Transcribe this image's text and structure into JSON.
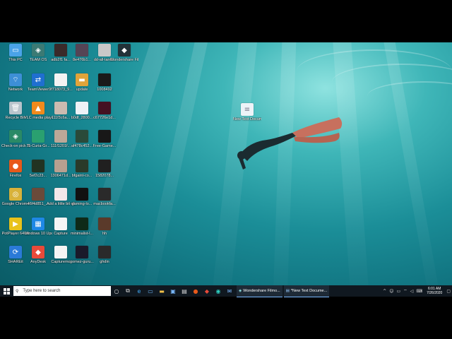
{
  "desktop": {
    "icons": [
      {
        "label": "This PC",
        "icon": "monitor-icon",
        "color": "#4aa3e8"
      },
      {
        "label": "TEAM OS",
        "icon": "app-icon",
        "color": "#3b7a74"
      },
      {
        "label": "adb2f1 fa...",
        "icon": "image-thumbnail",
        "color": "#3a2a2a"
      },
      {
        "label": "8e476b1...",
        "icon": "image-thumbnail",
        "color": "#554455"
      },
      {
        "label": "dd-all-land...",
        "icon": "image-thumbnail",
        "color": "#c8c8c8"
      },
      {
        "label": "Wondershare Filmora9",
        "icon": "filmora-icon",
        "color": "#233238"
      },
      {
        "label": "Network",
        "icon": "network-icon",
        "color": "#3d8fd6"
      },
      {
        "label": "TeamViewer",
        "icon": "teamviewer-icon",
        "color": "#1f6fd0"
      },
      {
        "label": "9f718073_9...",
        "icon": "document-icon",
        "color": "#f3f3f3"
      },
      {
        "label": "update",
        "icon": "folder-icon",
        "color": "#e0a43a"
      },
      {
        "label": "1008492",
        "icon": "image-thumbnail",
        "color": "#1a1a1a"
      },
      {
        "label": "Recycle Bin",
        "icon": "recycle-bin-icon",
        "color": "#b8c4cc"
      },
      {
        "label": "VLC media player",
        "icon": "vlc-icon",
        "color": "#f08a1c"
      },
      {
        "label": "111f3c6a...",
        "icon": "image-thumbnail",
        "color": "#ccbbb0"
      },
      {
        "label": "b0df_2800...",
        "icon": "image-thumbnail",
        "color": "#eef2f6"
      },
      {
        "label": "c67726e1d...",
        "icon": "image-thumbnail",
        "color": "#441122"
      },
      {
        "label": "Check-on pick Stuff",
        "icon": "app-icon",
        "color": "#2a8a66"
      },
      {
        "label": "75-Curia-Gr...",
        "icon": "image-thumbnail",
        "color": "#2aa070"
      },
      {
        "label": "111f1201f...",
        "icon": "image-thumbnail",
        "color": "#bca898"
      },
      {
        "label": "af478c452...",
        "icon": "image-thumbnail",
        "color": "#2a4a3a"
      },
      {
        "label": "Free-Game...",
        "icon": "image-thumbnail",
        "color": "#181818"
      },
      {
        "label": "Firefox",
        "icon": "firefox-icon",
        "color": "#e8591a"
      },
      {
        "label": "5ef2c23...",
        "icon": "image-thumbnail",
        "color": "#223322"
      },
      {
        "label": "1306471d...",
        "icon": "image-thumbnail",
        "color": "#b8a090"
      },
      {
        "label": "bfgaint-co...",
        "icon": "image-thumbnail",
        "color": "#2a3a2a"
      },
      {
        "label": "1582078...",
        "icon": "image-thumbnail",
        "color": "#202020"
      },
      {
        "label": "Google Chrome",
        "icon": "chrome-icon",
        "color": "#d8b23a"
      },
      {
        "label": "46f4d851_...",
        "icon": "image-thumbnail",
        "color": "#6a4a3a"
      },
      {
        "label": "Add a little bit of bo...",
        "icon": "document-icon",
        "color": "#f2e8ea"
      },
      {
        "label": "gaming-lo...",
        "icon": "image-thumbnail",
        "color": "#111111"
      },
      {
        "label": "macbookfa...",
        "icon": "image-thumbnail",
        "color": "#2a2a2a"
      },
      {
        "label": "PotPlayer 64 bit",
        "icon": "potplayer-icon",
        "color": "#e8c21a"
      },
      {
        "label": "Windows 10 Update As...",
        "icon": "windows-icon",
        "color": "#1e88e5"
      },
      {
        "label": "Capture",
        "icon": "image-thumbnail",
        "color": "#f5f5f5"
      },
      {
        "label": "minimalist-l...",
        "icon": "image-thumbnail",
        "color": "#0e2a18"
      },
      {
        "label": "hh",
        "icon": "image-thumbnail",
        "color": "#5a3a2a"
      },
      {
        "label": "SHAREit",
        "icon": "shareit-icon",
        "color": "#2a7ad8"
      },
      {
        "label": "AnyDesk",
        "icon": "anydesk-icon",
        "color": "#e84a3a"
      },
      {
        "label": "Capturemo",
        "icon": "image-thumbnail",
        "color": "#f5f5f5"
      },
      {
        "label": "gomez-guru...",
        "icon": "image-thumbnail",
        "color": "#1a1a2a"
      },
      {
        "label": "ghdin",
        "icon": "image-thumbnail",
        "color": "#2a2a2a"
      },
      {
        "label": "New Text Document",
        "icon": "text-document-icon",
        "color": "#eef3f8"
      }
    ]
  },
  "taskbar": {
    "search_placeholder": "Type here to search",
    "apps": [
      {
        "label": "Wondershare Filmo..."
      },
      {
        "label": "*New Text Docume..."
      }
    ],
    "clock_time": "6:01 AM",
    "clock_date": "7/26/2020",
    "accent": "#7ab8ff"
  }
}
